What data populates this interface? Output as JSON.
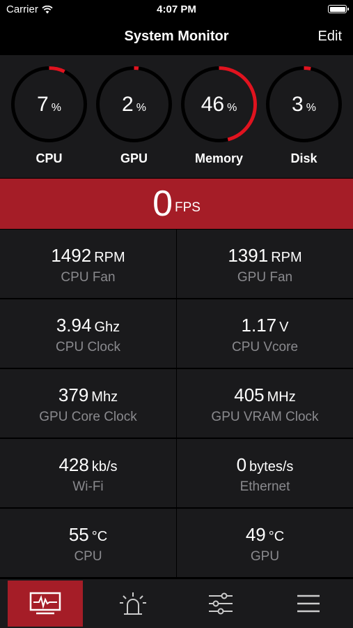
{
  "status_bar": {
    "carrier": "Carrier",
    "time": "4:07 PM"
  },
  "nav": {
    "title": "System Monitor",
    "edit_label": "Edit"
  },
  "accent_color": "#e0131f",
  "gauges": [
    {
      "label": "CPU",
      "value": "7",
      "unit": "%",
      "percent": 7
    },
    {
      "label": "GPU",
      "value": "2",
      "unit": "%",
      "percent": 2
    },
    {
      "label": "Memory",
      "value": "46",
      "unit": "%",
      "percent": 46
    },
    {
      "label": "Disk",
      "value": "3",
      "unit": "%",
      "percent": 3
    }
  ],
  "fps": {
    "value": "0",
    "unit": "FPS"
  },
  "stats": [
    {
      "value": "1492",
      "unit": "RPM",
      "name": "CPU Fan"
    },
    {
      "value": "1391",
      "unit": "RPM",
      "name": "GPU Fan"
    },
    {
      "value": "3.94",
      "unit": "Ghz",
      "name": "CPU Clock"
    },
    {
      "value": "1.17",
      "unit": "V",
      "name": "CPU Vcore"
    },
    {
      "value": "379",
      "unit": "Mhz",
      "name": "GPU Core Clock"
    },
    {
      "value": "405",
      "unit": "MHz",
      "name": "GPU VRAM Clock"
    },
    {
      "value": "428",
      "unit": "kb/s",
      "name": "Wi-Fi"
    },
    {
      "value": "0",
      "unit": "bytes/s",
      "name": "Ethernet"
    },
    {
      "value": "55",
      "unit": "°C",
      "name": "CPU"
    },
    {
      "value": "49",
      "unit": "°C",
      "name": "GPU"
    }
  ],
  "tabs": [
    {
      "icon": "monitor-icon",
      "active": true
    },
    {
      "icon": "alarm-icon",
      "active": false
    },
    {
      "icon": "sliders-icon",
      "active": false
    },
    {
      "icon": "menu-icon",
      "active": false
    }
  ]
}
